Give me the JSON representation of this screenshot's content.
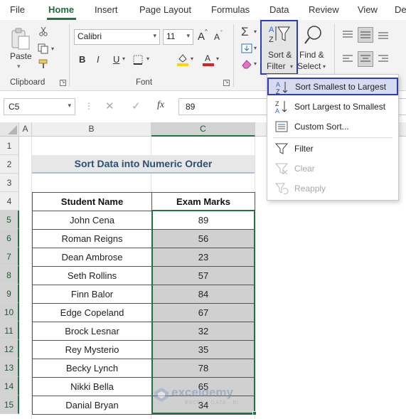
{
  "ribbon_tabs": [
    "File",
    "Home",
    "Insert",
    "Page Layout",
    "Formulas",
    "Data",
    "Review",
    "View",
    "De"
  ],
  "clipboard": {
    "paste_label": "Paste",
    "group_label": "Clipboard"
  },
  "font": {
    "name": "Calibri",
    "size": "11",
    "group_label": "Font",
    "bold": "B",
    "italic": "I",
    "underline": "U",
    "grow": "A",
    "shrink": "A",
    "fill_color": "#ffd400",
    "font_color": "#e02020"
  },
  "editing": {
    "sort_filter_label_1": "Sort &",
    "sort_filter_label_2": "Filter",
    "find_select_label_1": "Find &",
    "find_select_label_2": "Select"
  },
  "formula_bar": {
    "cell_ref": "C5",
    "fx": "fx",
    "value": "89"
  },
  "columns": [
    "A",
    "B",
    "C"
  ],
  "rows": [
    "1",
    "2",
    "3",
    "4",
    "5",
    "6",
    "7",
    "8",
    "9",
    "10",
    "11",
    "12",
    "13",
    "14",
    "15"
  ],
  "sheet": {
    "title": "Sort Data into Numeric Order",
    "headers": [
      "Student Name",
      "Exam Marks"
    ],
    "records": [
      {
        "name": "John Cena",
        "mark": "89"
      },
      {
        "name": "Roman Reigns",
        "mark": "56"
      },
      {
        "name": "Dean Ambrose",
        "mark": "23"
      },
      {
        "name": "Seth Rollins",
        "mark": "57"
      },
      {
        "name": "Finn Balor",
        "mark": "84"
      },
      {
        "name": "Edge Copeland",
        "mark": "67"
      },
      {
        "name": "Brock Lesnar",
        "mark": "32"
      },
      {
        "name": "Rey Mysterio",
        "mark": "35"
      },
      {
        "name": "Becky Lynch",
        "mark": "78"
      },
      {
        "name": "Nikki Bella",
        "mark": "65"
      },
      {
        "name": "Danial Bryan",
        "mark": "34"
      }
    ]
  },
  "sort_menu": {
    "items": [
      {
        "label": "Sort Smallest to Largest",
        "state": "highlighted"
      },
      {
        "label": "Sort Largest to Smallest",
        "state": "enabled"
      },
      {
        "label": "Custom Sort...",
        "state": "enabled"
      },
      {
        "label": "Filter",
        "state": "enabled"
      },
      {
        "label": "Clear",
        "state": "disabled"
      },
      {
        "label": "Reapply",
        "state": "disabled"
      }
    ]
  },
  "watermark": {
    "brand": "exceldemy",
    "tagline": "EXCEL · DATA · BI"
  },
  "colors": {
    "accent": "#217346",
    "highlight_border": "#2b3fb0",
    "title_text": "#2d4f73"
  }
}
